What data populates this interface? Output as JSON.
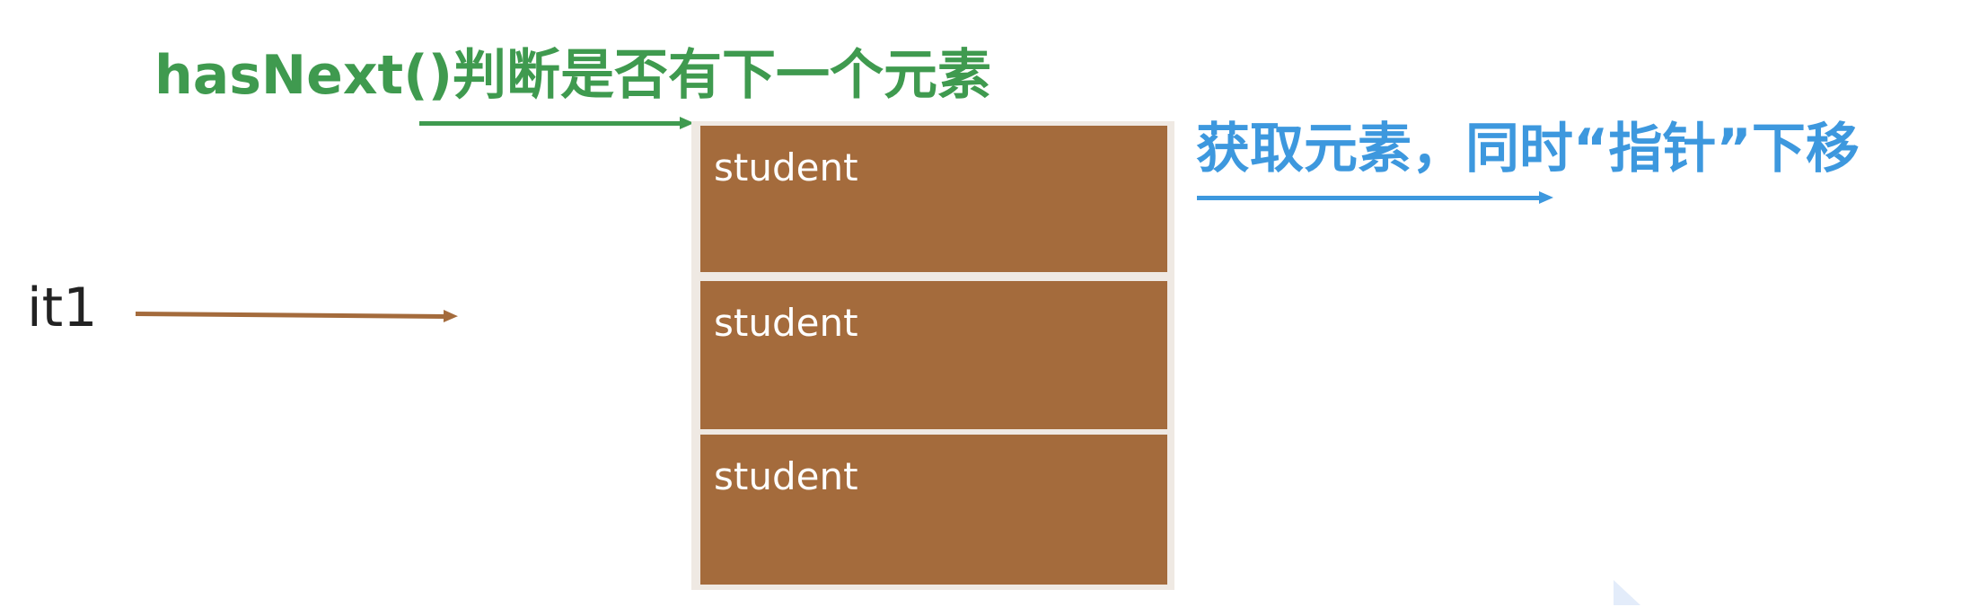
{
  "labels": {
    "hasnext": "hasNext()判断是否有下一个元素",
    "next": "获取元素，同时“指针”下移",
    "iterator": "it1"
  },
  "stack": {
    "elements": [
      "student",
      "student",
      "student"
    ]
  },
  "colors": {
    "hasnext_accent": "#3f9a4f",
    "next_accent": "#3d98de",
    "iterator_arrow": "#a46b3c",
    "cell_fill": "#a46b3c",
    "cell_text": "#ffffff",
    "frame": "#efe9e3"
  }
}
